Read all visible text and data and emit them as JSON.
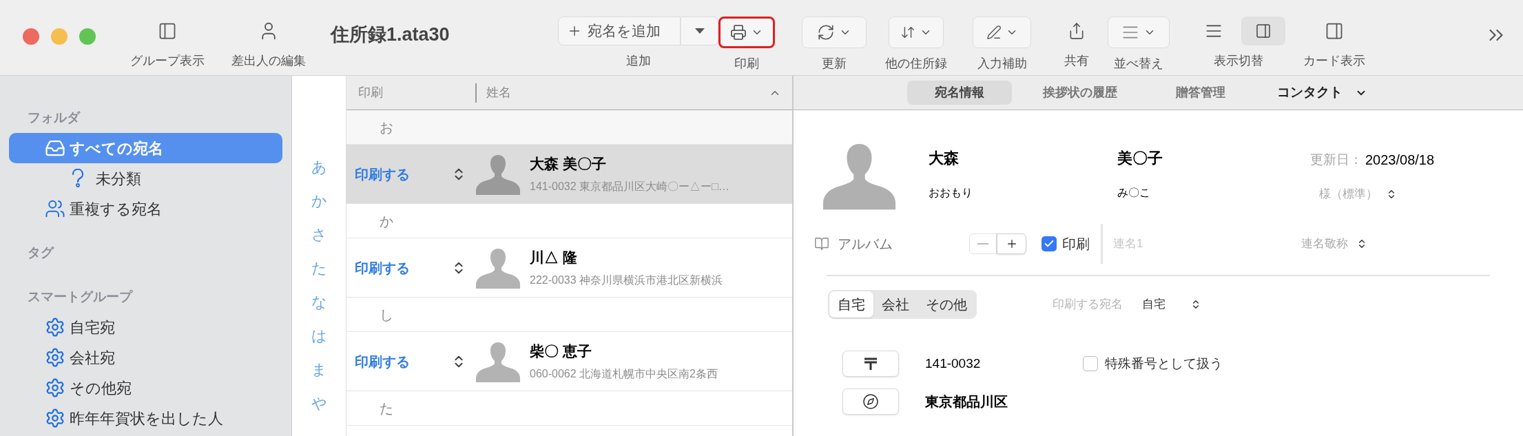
{
  "toolbar": {
    "left_items": [
      {
        "kind": "plain",
        "label": "グループ表示"
      },
      {
        "kind": "plain",
        "label": "差出人の編集"
      }
    ],
    "title": "住所録1.ata30",
    "items": [
      {
        "kind": "split",
        "label": "追加",
        "button_text": "宛名を追加"
      },
      {
        "kind": "dropdown",
        "label": "印刷",
        "highlighted": true
      },
      {
        "kind": "dropdown",
        "label": "更新",
        "highlighted": false
      },
      {
        "kind": "dropdown",
        "label": "他の住所録",
        "highlighted": false
      },
      {
        "kind": "dropdown",
        "label": "入力補助",
        "highlighted": false
      },
      {
        "kind": "plain",
        "label": "共有"
      },
      {
        "kind": "dropdown",
        "label": "並べ替え",
        "highlighted": false
      },
      {
        "kind": "segmented",
        "label": "表示切替",
        "segments": [
          {
            "selected": false
          },
          {
            "selected": true
          }
        ]
      },
      {
        "kind": "plain",
        "label": "カード表示"
      }
    ]
  },
  "sidebar": {
    "sections": [
      {
        "title": "フォルダ",
        "items": [
          {
            "kind": "inbox",
            "label": "すべての宛名",
            "selected": true,
            "children": [
              {
                "kind": "unfiled",
                "label": "未分類",
                "selected": false
              }
            ]
          },
          {
            "kind": "duplicates",
            "label": "重複する宛名",
            "selected": false
          }
        ]
      },
      {
        "title": "タグ"
      },
      {
        "title": "スマートグループ",
        "items": [
          {
            "kind": "smart",
            "label": "自宅宛",
            "selected": false
          },
          {
            "kind": "smart",
            "label": "会社宛",
            "selected": false
          },
          {
            "kind": "smart",
            "label": "その他宛",
            "selected": false
          },
          {
            "kind": "smart",
            "label": "昨年年賀状を出した人",
            "selected": false
          }
        ]
      }
    ]
  },
  "index": [
    "あ",
    "か",
    "さ",
    "た",
    "な",
    "は",
    "ま",
    "や"
  ],
  "list": {
    "columns": [
      "印刷",
      "姓名"
    ],
    "rows": [
      {
        "kind": "group",
        "label": "お"
      },
      {
        "kind": "contact",
        "print": "印刷する",
        "name": "大森 美〇子",
        "address": "141-0032 東京都品川区大崎〇ー△ー□…",
        "selected": true
      },
      {
        "kind": "group",
        "label": "か"
      },
      {
        "kind": "contact",
        "print": "印刷する",
        "name": "川△ 隆",
        "address": "222-0033 神奈川県横浜市港北区新横浜",
        "selected": false
      },
      {
        "kind": "group",
        "label": "し"
      },
      {
        "kind": "contact",
        "print": "印刷する",
        "name": "柴〇 恵子",
        "address": "060-0062 北海道札幌市中央区南2条西",
        "selected": false
      },
      {
        "kind": "group",
        "label": "た"
      }
    ]
  },
  "detail": {
    "tabs": [
      {
        "label": "宛名情報",
        "selected": true
      },
      {
        "label": "挨拶状の履歴",
        "selected": false
      },
      {
        "label": "贈答管理",
        "selected": false
      }
    ],
    "contact_menu": "コンタクト",
    "family_name": "大森",
    "given_name": "美〇子",
    "family_reading": "おおもり",
    "given_reading": "み〇こ",
    "updated_label": "更新日：",
    "updated_value": "2023/08/18",
    "honorific": "様（標準）",
    "album": "アルバム",
    "print_check": {
      "label": "印刷",
      "checked": true
    },
    "joint_name_placeholder": "連名1",
    "joint_honorific": "連名敬称",
    "address_tabs": [
      {
        "label": "自宅",
        "selected": true
      },
      {
        "label": "会社",
        "selected": false
      },
      {
        "label": "その他",
        "selected": false
      }
    ],
    "print_address_label": "印刷する宛名",
    "print_address_value": "自宅",
    "postal_code": "141-0032",
    "special_number": {
      "label": "特殊番号として扱う",
      "checked": false
    },
    "address_line": "東京都品川区"
  }
}
